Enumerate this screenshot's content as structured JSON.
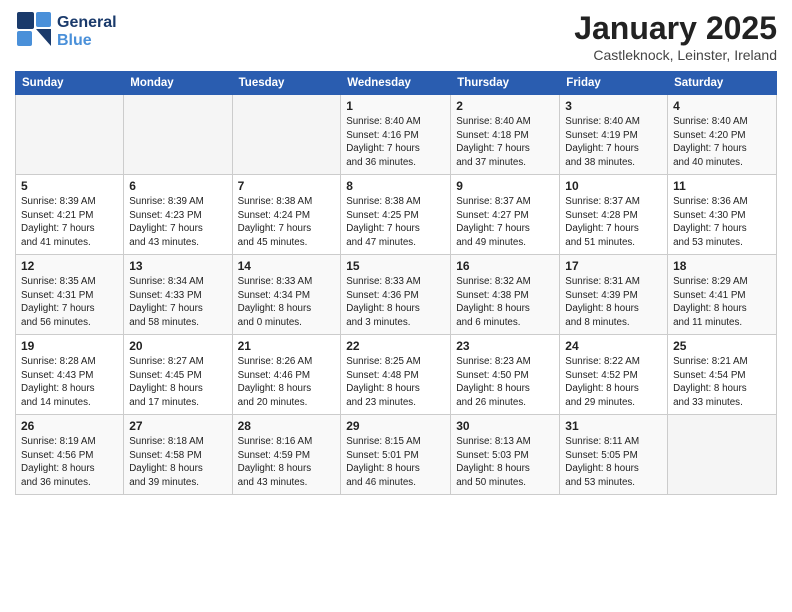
{
  "header": {
    "logo_line1": "General",
    "logo_line2": "Blue",
    "month_year": "January 2025",
    "location": "Castleknock, Leinster, Ireland"
  },
  "weekdays": [
    "Sunday",
    "Monday",
    "Tuesday",
    "Wednesday",
    "Thursday",
    "Friday",
    "Saturday"
  ],
  "weeks": [
    [
      {
        "num": "",
        "info": ""
      },
      {
        "num": "",
        "info": ""
      },
      {
        "num": "",
        "info": ""
      },
      {
        "num": "1",
        "info": "Sunrise: 8:40 AM\nSunset: 4:16 PM\nDaylight: 7 hours\nand 36 minutes."
      },
      {
        "num": "2",
        "info": "Sunrise: 8:40 AM\nSunset: 4:18 PM\nDaylight: 7 hours\nand 37 minutes."
      },
      {
        "num": "3",
        "info": "Sunrise: 8:40 AM\nSunset: 4:19 PM\nDaylight: 7 hours\nand 38 minutes."
      },
      {
        "num": "4",
        "info": "Sunrise: 8:40 AM\nSunset: 4:20 PM\nDaylight: 7 hours\nand 40 minutes."
      }
    ],
    [
      {
        "num": "5",
        "info": "Sunrise: 8:39 AM\nSunset: 4:21 PM\nDaylight: 7 hours\nand 41 minutes."
      },
      {
        "num": "6",
        "info": "Sunrise: 8:39 AM\nSunset: 4:23 PM\nDaylight: 7 hours\nand 43 minutes."
      },
      {
        "num": "7",
        "info": "Sunrise: 8:38 AM\nSunset: 4:24 PM\nDaylight: 7 hours\nand 45 minutes."
      },
      {
        "num": "8",
        "info": "Sunrise: 8:38 AM\nSunset: 4:25 PM\nDaylight: 7 hours\nand 47 minutes."
      },
      {
        "num": "9",
        "info": "Sunrise: 8:37 AM\nSunset: 4:27 PM\nDaylight: 7 hours\nand 49 minutes."
      },
      {
        "num": "10",
        "info": "Sunrise: 8:37 AM\nSunset: 4:28 PM\nDaylight: 7 hours\nand 51 minutes."
      },
      {
        "num": "11",
        "info": "Sunrise: 8:36 AM\nSunset: 4:30 PM\nDaylight: 7 hours\nand 53 minutes."
      }
    ],
    [
      {
        "num": "12",
        "info": "Sunrise: 8:35 AM\nSunset: 4:31 PM\nDaylight: 7 hours\nand 56 minutes."
      },
      {
        "num": "13",
        "info": "Sunrise: 8:34 AM\nSunset: 4:33 PM\nDaylight: 7 hours\nand 58 minutes."
      },
      {
        "num": "14",
        "info": "Sunrise: 8:33 AM\nSunset: 4:34 PM\nDaylight: 8 hours\nand 0 minutes."
      },
      {
        "num": "15",
        "info": "Sunrise: 8:33 AM\nSunset: 4:36 PM\nDaylight: 8 hours\nand 3 minutes."
      },
      {
        "num": "16",
        "info": "Sunrise: 8:32 AM\nSunset: 4:38 PM\nDaylight: 8 hours\nand 6 minutes."
      },
      {
        "num": "17",
        "info": "Sunrise: 8:31 AM\nSunset: 4:39 PM\nDaylight: 8 hours\nand 8 minutes."
      },
      {
        "num": "18",
        "info": "Sunrise: 8:29 AM\nSunset: 4:41 PM\nDaylight: 8 hours\nand 11 minutes."
      }
    ],
    [
      {
        "num": "19",
        "info": "Sunrise: 8:28 AM\nSunset: 4:43 PM\nDaylight: 8 hours\nand 14 minutes."
      },
      {
        "num": "20",
        "info": "Sunrise: 8:27 AM\nSunset: 4:45 PM\nDaylight: 8 hours\nand 17 minutes."
      },
      {
        "num": "21",
        "info": "Sunrise: 8:26 AM\nSunset: 4:46 PM\nDaylight: 8 hours\nand 20 minutes."
      },
      {
        "num": "22",
        "info": "Sunrise: 8:25 AM\nSunset: 4:48 PM\nDaylight: 8 hours\nand 23 minutes."
      },
      {
        "num": "23",
        "info": "Sunrise: 8:23 AM\nSunset: 4:50 PM\nDaylight: 8 hours\nand 26 minutes."
      },
      {
        "num": "24",
        "info": "Sunrise: 8:22 AM\nSunset: 4:52 PM\nDaylight: 8 hours\nand 29 minutes."
      },
      {
        "num": "25",
        "info": "Sunrise: 8:21 AM\nSunset: 4:54 PM\nDaylight: 8 hours\nand 33 minutes."
      }
    ],
    [
      {
        "num": "26",
        "info": "Sunrise: 8:19 AM\nSunset: 4:56 PM\nDaylight: 8 hours\nand 36 minutes."
      },
      {
        "num": "27",
        "info": "Sunrise: 8:18 AM\nSunset: 4:58 PM\nDaylight: 8 hours\nand 39 minutes."
      },
      {
        "num": "28",
        "info": "Sunrise: 8:16 AM\nSunset: 4:59 PM\nDaylight: 8 hours\nand 43 minutes."
      },
      {
        "num": "29",
        "info": "Sunrise: 8:15 AM\nSunset: 5:01 PM\nDaylight: 8 hours\nand 46 minutes."
      },
      {
        "num": "30",
        "info": "Sunrise: 8:13 AM\nSunset: 5:03 PM\nDaylight: 8 hours\nand 50 minutes."
      },
      {
        "num": "31",
        "info": "Sunrise: 8:11 AM\nSunset: 5:05 PM\nDaylight: 8 hours\nand 53 minutes."
      },
      {
        "num": "",
        "info": ""
      }
    ]
  ]
}
